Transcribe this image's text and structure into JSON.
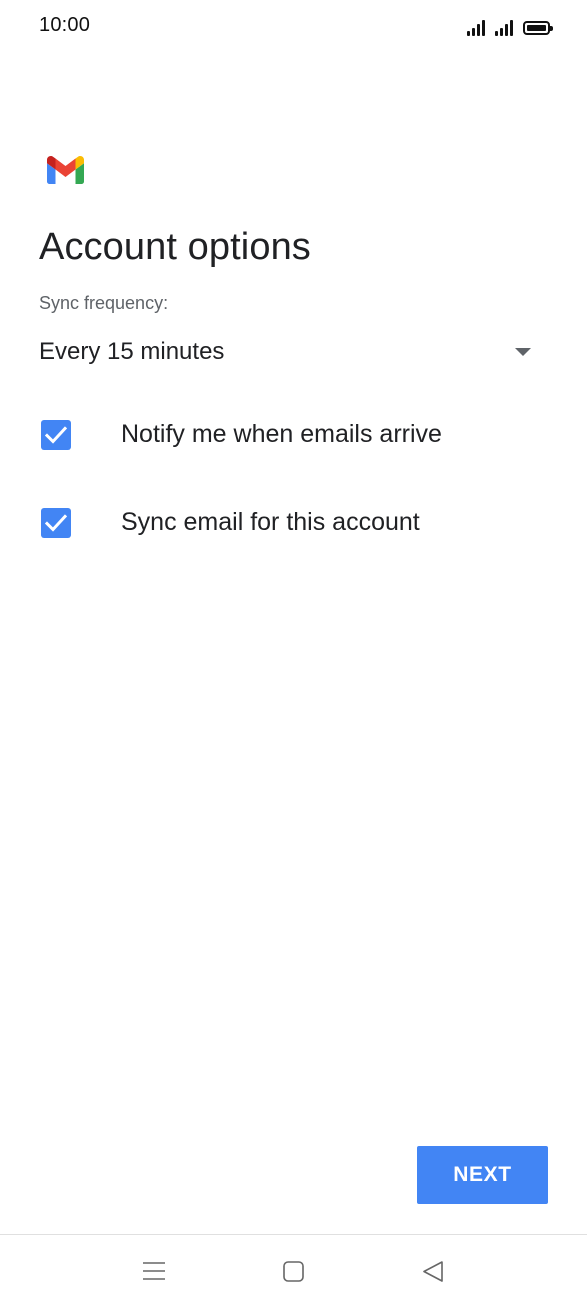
{
  "status_bar": {
    "time": "10:00",
    "icons": [
      "signal-icon",
      "signal-icon",
      "battery-icon"
    ]
  },
  "logo": {
    "icon": "gmail-logo-icon",
    "colors": {
      "blue": "#4285f4",
      "red": "#ea4335",
      "yellow": "#fbbc04",
      "green": "#34a853",
      "dark_red": "#c5221f"
    }
  },
  "page": {
    "title": "Account options"
  },
  "sync": {
    "label": "Sync frequency:",
    "selected_value": "Every 15 minutes"
  },
  "options": [
    {
      "label": "Notify me when emails arrive",
      "checked": true
    },
    {
      "label": "Sync email for this account",
      "checked": true
    }
  ],
  "actions": {
    "next_label": "NEXT"
  },
  "colors": {
    "accent": "#4285f4",
    "text_primary": "#202124",
    "text_secondary": "#5f6368"
  },
  "nav_bar": {
    "icons": [
      "menu-icon",
      "home-icon",
      "back-icon"
    ]
  }
}
